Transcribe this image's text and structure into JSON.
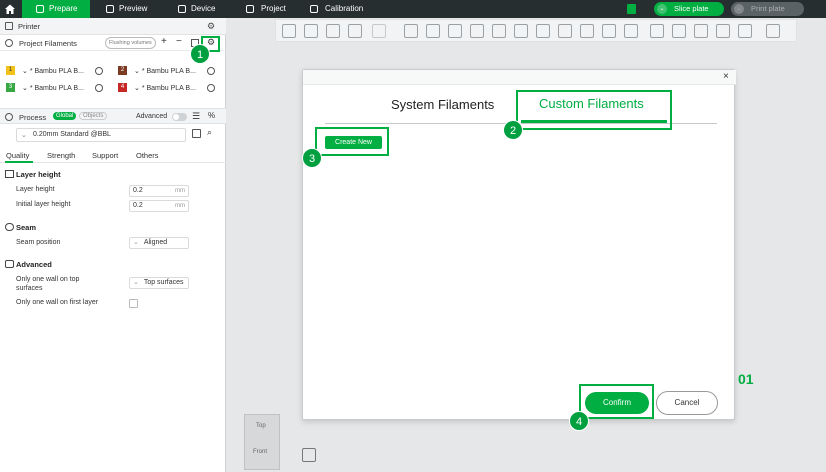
{
  "topbar": {
    "tabs": [
      {
        "label": "Prepare",
        "icon": "cube-icon"
      },
      {
        "label": "Preview",
        "icon": "preview-icon"
      },
      {
        "label": "Device",
        "icon": "device-icon"
      },
      {
        "label": "Project",
        "icon": "project-icon"
      },
      {
        "label": "Calibration",
        "icon": "calibration-icon"
      }
    ],
    "slice_label": "Slice plate",
    "print_label": "Print plate"
  },
  "left": {
    "printer_label": "Printer",
    "filaments_label": "Project Filaments",
    "flushing_label": "Flushing volumes",
    "filaments": [
      {
        "num": "1",
        "color": "#f2c21b",
        "name": "* Bambu PLA B..."
      },
      {
        "num": "2",
        "color": "#7a3b22",
        "name": "* Bambu PLA B..."
      },
      {
        "num": "3",
        "color": "#38a845",
        "name": "* Bambu PLA B..."
      },
      {
        "num": "4",
        "color": "#c62828",
        "name": "* Bambu PLA B..."
      }
    ],
    "process_label": "Process",
    "global_label": "Global",
    "objects_label": "Objects",
    "advanced_label": "Advanced",
    "profile_value": "0.20mm Standard @BBL",
    "tabs": [
      "Quality",
      "Strength",
      "Support",
      "Others"
    ],
    "sections": {
      "layer_height": {
        "title": "Layer height",
        "layer_height_label": "Layer height",
        "layer_height_value": "0.2",
        "initial_label": "Initial layer height",
        "initial_value": "0.2",
        "unit": "mm"
      },
      "seam": {
        "title": "Seam",
        "position_label": "Seam position",
        "position_value": "Aligned"
      },
      "advanced": {
        "title": "Advanced",
        "one_wall_top_label_1": "Only one wall on top",
        "one_wall_top_label_2": "surfaces",
        "one_wall_top_value": "Top surfaces",
        "one_wall_first_label": "Only one wall on first layer"
      }
    }
  },
  "modal": {
    "tab_system": "System Filaments",
    "tab_custom": "Custom Filaments",
    "create_new": "Create New",
    "confirm": "Confirm",
    "cancel": "Cancel",
    "close": "×"
  },
  "annotations": [
    "1",
    "2",
    "3",
    "4"
  ],
  "viewcube": {
    "top": "Top",
    "front": "Front"
  },
  "plate_number": "01",
  "colors": {
    "accent": "#00ae42",
    "topbar": "#262e30"
  }
}
